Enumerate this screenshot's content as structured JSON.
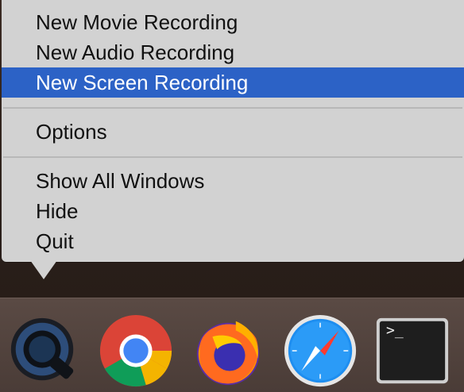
{
  "menu": {
    "items": [
      {
        "label": "New Movie Recording",
        "selected": false
      },
      {
        "label": "New Audio Recording",
        "selected": false
      },
      {
        "label": "New Screen Recording",
        "selected": true
      },
      {
        "label": "Options",
        "selected": false
      },
      {
        "label": "Show All Windows",
        "selected": false
      },
      {
        "label": "Hide",
        "selected": false
      },
      {
        "label": "Quit",
        "selected": false
      }
    ],
    "selection_color": "#2c62c6"
  },
  "dock": {
    "apps": [
      {
        "icon": "quicktime-icon"
      },
      {
        "icon": "chrome-icon"
      },
      {
        "icon": "firefox-icon"
      },
      {
        "icon": "safari-icon"
      },
      {
        "icon": "terminal-icon",
        "prompt": ">_"
      }
    ]
  }
}
